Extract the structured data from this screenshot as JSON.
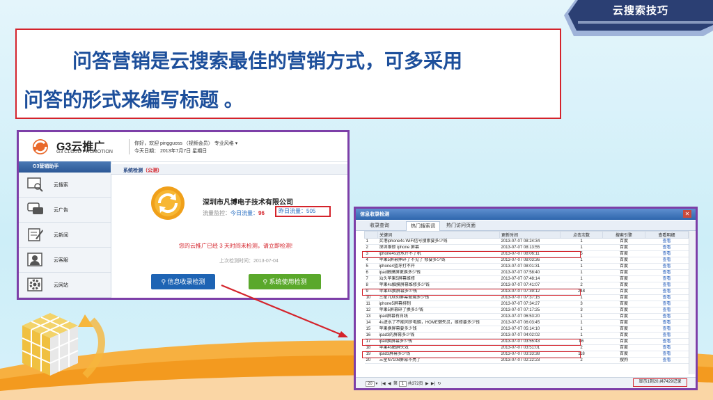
{
  "tab_label": "云搜索技巧",
  "title": {
    "line1": "问答营销是云搜索最佳的营销方式，可多采用",
    "line2": "问答的形式来编写标题 。"
  },
  "colors": {
    "accent_red": "#d4232b",
    "title_blue": "#1d4f9b",
    "frame_purple": "#7d3fa8",
    "tab_navy": "#2b3f73"
  },
  "left_screen": {
    "brand": "G3云推广",
    "brand_sub": "G3 CLOUD PROMOTION",
    "greeting": "你好，欢迎 pingguoss 〈视频会员〉  专业风格 ▾",
    "today": "今天日期：  2013年7月7日  星期日",
    "sidebar_title": "G3营销助手",
    "sidebar_items": [
      {
        "label": "云搜索",
        "icon": "search-monitor-icon"
      },
      {
        "label": "云广告",
        "icon": "chat-bubble-icon"
      },
      {
        "label": "云新闻",
        "icon": "edit-note-icon"
      },
      {
        "label": "云客服",
        "icon": "customer-service-icon"
      },
      {
        "label": "云网站",
        "icon": "gear-icon"
      }
    ],
    "tab_title": "系统检测",
    "tab_status": "（公测）",
    "company": "深圳市凡博电子技术有限公司",
    "flow_label": "流量监控：",
    "today_flow_label": "今日流量：",
    "today_flow_value": "96",
    "yesterday_flow": "昨日流量：505",
    "warning": "您的云推广已经 3 天时间未检测，请立即检测!",
    "last_check": "上次检测时间：2013-07-04",
    "button_check": "信息收录检测",
    "button_system": "系统使用检测"
  },
  "right_screen": {
    "window_title": "信息收录检测",
    "tabs": [
      "收录查询",
      "热门搜索词",
      "热门访问页面"
    ],
    "active_tab": 1,
    "columns": [
      "",
      "关键词",
      "更新时间",
      "点击次数",
      "搜索引擎",
      "查看明细"
    ],
    "rows": [
      {
        "n": "1",
        "kw": "买港iphone4s WiFi信号搜索要多少钱",
        "time": "2013-07-07 08:24:34",
        "clicks": "1",
        "engine": "百度",
        "view": "查看"
      },
      {
        "n": "2",
        "kw": "深圳维修 iphone 屏幕",
        "time": "2013-07-07 08:13:55",
        "clicks": "1",
        "engine": "百度",
        "view": "查看"
      },
      {
        "n": "3",
        "kw": "iphone4s进水开不了机",
        "time": "2013-07-07 08:06:11",
        "clicks": "5",
        "engine": "百度",
        "view": "查看"
      },
      {
        "n": "4",
        "kw": "苹果5屏幕摔碎了不见了 修要多少钱",
        "time": "2013-07-07 08:03:36",
        "clicks": "1",
        "engine": "百度",
        "view": "查看"
      },
      {
        "n": "5",
        "kw": "iphone4蓝牙打不开",
        "time": "2013-07-07 08:01:31",
        "clicks": "1",
        "engine": "百度",
        "view": "查看"
      },
      {
        "n": "6",
        "kw": "ipad触摸屏更换多少钱",
        "time": "2013-07-07 07:58:40",
        "clicks": "1",
        "engine": "百度",
        "view": "查看"
      },
      {
        "n": "7",
        "kw": "汕头苹果5屏幕维修",
        "time": "2013-07-07 07:48:14",
        "clicks": "1",
        "engine": "百度",
        "view": "查看"
      },
      {
        "n": "8",
        "kw": "苹果4s触摸屏幕维修多少钱",
        "time": "2013-07-07 07:41:07",
        "clicks": "2",
        "engine": "百度",
        "view": "查看"
      },
      {
        "n": "9",
        "kw": "苹果4s换屏幕多少钱",
        "time": "2013-07-07 07:39:12",
        "clicks": "248",
        "engine": "百度",
        "view": "查看"
      },
      {
        "n": "10",
        "kw": "三星7D930屏幕玻璃多少钱",
        "time": "2013-07-07 07:37:15",
        "clicks": "1",
        "engine": "百度",
        "view": "查看"
      },
      {
        "n": "11",
        "kw": "iphone5屏幕排制",
        "time": "2013-07-07 07:34:27",
        "clicks": "3",
        "engine": "百度",
        "view": "查看"
      },
      {
        "n": "12",
        "kw": "苹果5屏幕碎了换多少钱",
        "time": "2013-07-07 07:17:25",
        "clicks": "3",
        "engine": "百度",
        "view": "查看"
      },
      {
        "n": "13",
        "kw": "ipad屏幕有白线",
        "time": "2013-07-07 06:53:20",
        "clicks": "1",
        "engine": "百度",
        "view": "查看"
      },
      {
        "n": "14",
        "kw": "4s进水了不能同步电脑，HOME键失灵，维修要多少钱",
        "time": "2013-07-07 06:03:45",
        "clicks": "1",
        "engine": "百度",
        "view": "查看"
      },
      {
        "n": "15",
        "kw": "苹果换屏幕要多少钱",
        "time": "2013-07-07 05:14:10",
        "clicks": "1",
        "engine": "百度",
        "view": "查看"
      },
      {
        "n": "16",
        "kw": "ipad3的屏幕多少钱",
        "time": "2013-07-07 04:02:02",
        "clicks": "1",
        "engine": "百度",
        "view": "查看"
      },
      {
        "n": "17",
        "kw": "ipad换屏幕多少钱",
        "time": "2013-07-07 03:55:43",
        "clicks": "86",
        "engine": "百度",
        "view": "查看"
      },
      {
        "n": "18",
        "kw": "苹果4s触屏失效",
        "time": "2013-07-07 03:51:01",
        "clicks": "2",
        "engine": "百度",
        "view": "查看"
      },
      {
        "n": "19",
        "kw": "ipad3屏幕多少钱",
        "time": "2013-07-07 03:33:38",
        "clicks": "118",
        "engine": "百度",
        "view": "查看"
      },
      {
        "n": "20",
        "kw": "三星N7108屏幕不亮了",
        "time": "2013-07-07 02:22:23",
        "clicks": "2",
        "engine": "搜狗",
        "view": "查看"
      }
    ],
    "highlighted_rows": [
      3,
      9,
      17,
      19
    ],
    "pager": {
      "page_size": "20",
      "prev_page_label": "第",
      "page_value": "1",
      "total_pages": "共372页"
    },
    "record_count": "显示1到20,共7429记录"
  }
}
